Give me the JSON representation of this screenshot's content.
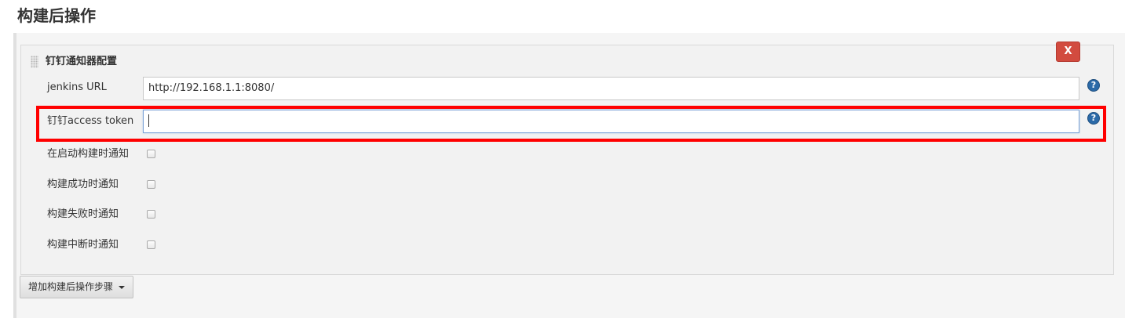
{
  "section": {
    "title": "构建后操作"
  },
  "panel": {
    "title": "钉钉通知器配置",
    "delete_label": "X",
    "jenkins_url": {
      "label": "jenkins URL",
      "value": "http://192.168.1.1:8080/"
    },
    "access_token": {
      "label": "钉钉access token",
      "value": ""
    },
    "checkboxes": [
      {
        "label": "在启动构建时通知",
        "checked": false
      },
      {
        "label": "构建成功时通知",
        "checked": false
      },
      {
        "label": "构建失败时通知",
        "checked": false
      },
      {
        "label": "构建中断时通知",
        "checked": false
      }
    ],
    "help_icon": "help-circle-icon"
  },
  "add_step_button": {
    "label": "增加构建后操作步骤"
  },
  "colors": {
    "delete_button": "#d24b3f",
    "highlight": "#ff0000",
    "help_icon": "#2b6aa8"
  }
}
